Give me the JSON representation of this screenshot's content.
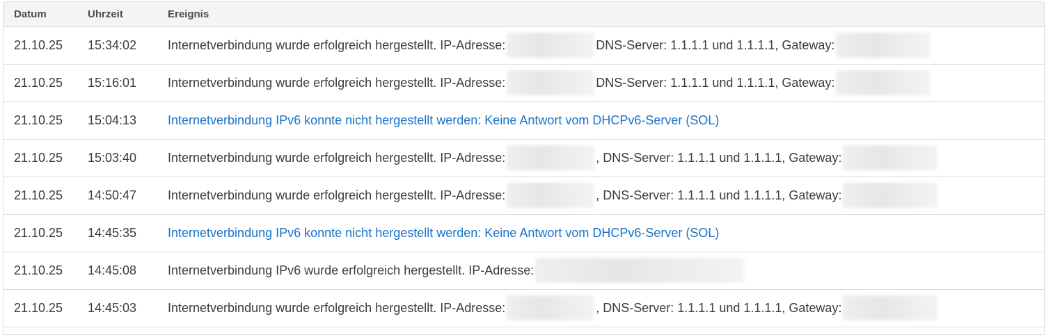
{
  "table": {
    "headers": {
      "date": "Datum",
      "time": "Uhrzeit",
      "event": "Ereignis"
    },
    "rows": [
      {
        "date": "21.10.25",
        "time": "15:34:02",
        "type": "ipv4",
        "text_a": "Internetverbindung wurde erfolgreich hergestellt. IP-Adresse:",
        "text_b": "DNS-Server: 1.1.1.1 und 1.1.1.1, Gateway:"
      },
      {
        "date": "21.10.25",
        "time": "15:16:01",
        "type": "ipv4",
        "text_a": "Internetverbindung wurde erfolgreich hergestellt. IP-Adresse:",
        "text_b": "DNS-Server: 1.1.1.1 und 1.1.1.1, Gateway:"
      },
      {
        "date": "21.10.25",
        "time": "15:04:13",
        "type": "error",
        "text_a": "Internetverbindung IPv6 konnte nicht hergestellt werden: Keine Antwort vom DHCPv6-Server (SOL)"
      },
      {
        "date": "21.10.25",
        "time": "15:03:40",
        "type": "ipv4",
        "text_a": "Internetverbindung wurde erfolgreich hergestellt. IP-Adresse:",
        "text_b": ", DNS-Server: 1.1.1.1 und 1.1.1.1, Gateway:"
      },
      {
        "date": "21.10.25",
        "time": "14:50:47",
        "type": "ipv4",
        "text_a": "Internetverbindung wurde erfolgreich hergestellt. IP-Adresse:",
        "text_b": ", DNS-Server: 1.1.1.1 und 1.1.1.1, Gateway:"
      },
      {
        "date": "21.10.25",
        "time": "14:45:35",
        "type": "error",
        "text_a": "Internetverbindung IPv6 konnte nicht hergestellt werden: Keine Antwort vom DHCPv6-Server (SOL)"
      },
      {
        "date": "21.10.25",
        "time": "14:45:08",
        "type": "ipv6",
        "text_a": "Internetverbindung IPv6 wurde erfolgreich hergestellt. IP-Adresse:"
      },
      {
        "date": "21.10.25",
        "time": "14:45:03",
        "type": "ipv4",
        "text_a": "Internetverbindung wurde erfolgreich hergestellt. IP-Adresse:",
        "text_b": ", DNS-Server: 1.1.1.1 und 1.1.1.1, Gateway:"
      }
    ]
  },
  "colors": {
    "error_link": "#1a73c8",
    "text": "#3c3c3c",
    "border": "#dcdcdc",
    "header_bg": "#f4f4f4"
  }
}
